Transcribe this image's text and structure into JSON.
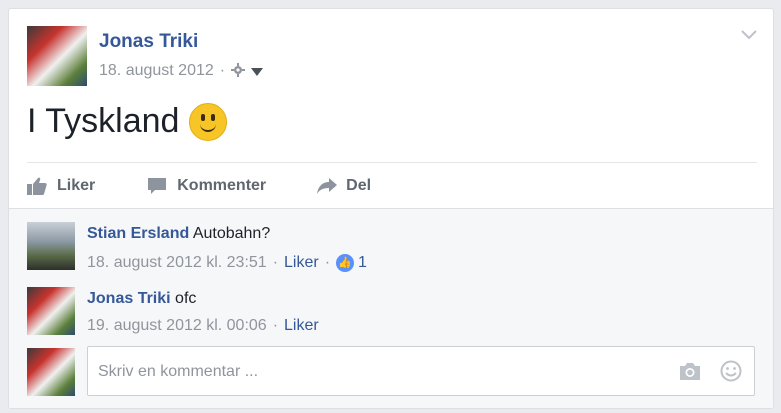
{
  "post": {
    "author": "Jonas Triki",
    "date": "18. august 2012",
    "separator": "·",
    "text": "I Tyskland",
    "emoji": "smiley",
    "icons": [
      "gear-icon",
      "caret-down-icon",
      "chevron-down-icon"
    ]
  },
  "actions": {
    "like": "Liker",
    "comment": "Kommenter",
    "share": "Del"
  },
  "comments": [
    {
      "name": "Stian Ersland",
      "text": "Autobahn?",
      "timestamp": "18. august 2012 kl. 23:51",
      "like_label": "Liker",
      "like_count": "1"
    },
    {
      "name": "Jonas Triki",
      "text": "ofc",
      "timestamp": "19. august 2012 kl. 00:06",
      "like_label": "Liker"
    }
  ],
  "composer": {
    "placeholder": "Skriv en kommentar ...",
    "icons": [
      "camera-icon",
      "emoji-icon"
    ]
  },
  "colors": {
    "name_blue": "#365899",
    "meta_gray": "#90949c",
    "like_badge": "#5890ff"
  }
}
